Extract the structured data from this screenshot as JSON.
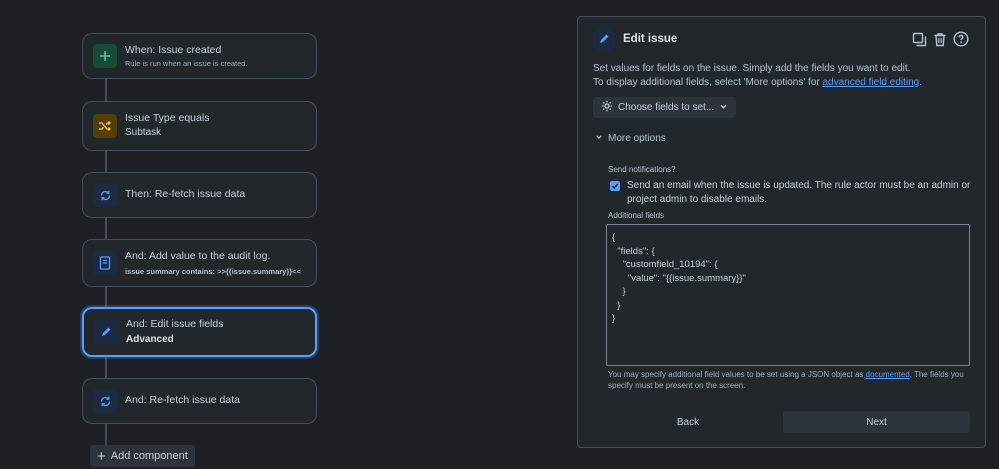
{
  "flow": {
    "steps": [
      {
        "title": "When: Issue created",
        "subtitle": "Rule is run when an issue is created.",
        "icon": "plus-icon"
      },
      {
        "title": "Issue Type equals",
        "subtitle": "Subtask",
        "icon": "shuffle-icon"
      },
      {
        "title": "Then: Re-fetch issue data",
        "icon": "refresh-icon"
      },
      {
        "title": "And: Add value to the audit log.",
        "subtitle": "issue summary contains: >>{{issue.summary}}<<",
        "icon": "audit-log-icon"
      },
      {
        "title": "And: Edit issue fields",
        "subtitle": "Advanced",
        "icon": "pencil-icon"
      },
      {
        "title": "And: Re-fetch issue data",
        "icon": "refresh-icon"
      }
    ],
    "add_component": "Add component"
  },
  "panel": {
    "title": "Edit issue",
    "desc_line1": "Set values for fields on the issue. Simply add the fields you want to edit.",
    "desc_line2_prefix": "To display additional fields, select 'More options' for ",
    "desc_link": "advanced field editing",
    "desc_line2_suffix": ".",
    "choose_fields": "Choose fields to set...",
    "more_options": "More options",
    "send_notifications_label": "Send notifications?",
    "send_email_text": "Send an email when the issue is updated. The rule actor must be an admin or project admin to disable emails.",
    "send_email_checked": true,
    "additional_fields_label": "Additional fields",
    "additional_fields_value": "{\n  \"fields\": {\n    \"customfield_10194\": {\n      \"value\": \"{{issue.summary}}\"\n    }\n  }\n}",
    "hint_prefix": "You may specify additional field values to be set using a JSON object as ",
    "hint_link": "documented",
    "hint_suffix": ". The fields you specify must be present on the screen.",
    "back": "Back",
    "next": "Next"
  },
  "colors": {
    "background": "#1d2125",
    "accent": "#579dff",
    "card_border": "#454f59"
  }
}
